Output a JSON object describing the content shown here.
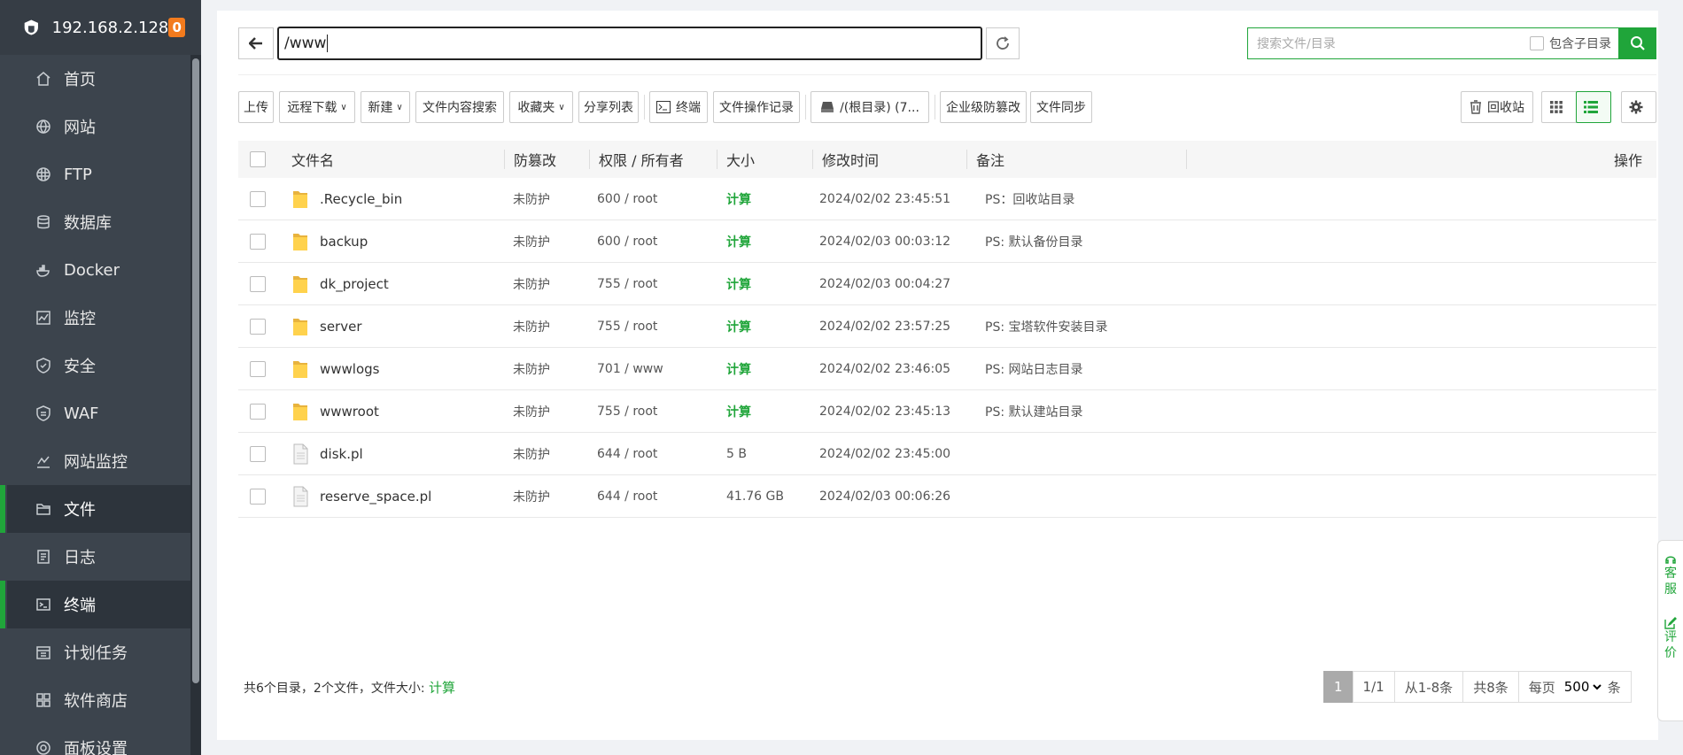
{
  "sidebar": {
    "ip": "192.168.2.128",
    "badge": "0",
    "items": [
      {
        "label": "首页",
        "icon": "home-icon"
      },
      {
        "label": "网站",
        "icon": "globe-icon"
      },
      {
        "label": "FTP",
        "icon": "ftp-icon"
      },
      {
        "label": "数据库",
        "icon": "database-icon"
      },
      {
        "label": "Docker",
        "icon": "docker-icon"
      },
      {
        "label": "监控",
        "icon": "monitor-icon"
      },
      {
        "label": "安全",
        "icon": "shield-icon"
      },
      {
        "label": "WAF",
        "icon": "waf-icon"
      },
      {
        "label": "网站监控",
        "icon": "chart-line-icon"
      },
      {
        "label": "文件",
        "icon": "folder-icon"
      },
      {
        "label": "日志",
        "icon": "log-icon"
      },
      {
        "label": "终端",
        "icon": "terminal-icon"
      },
      {
        "label": "计划任务",
        "icon": "calendar-icon"
      },
      {
        "label": "软件商店",
        "icon": "apps-icon"
      },
      {
        "label": "面板设置",
        "icon": "settings-icon"
      }
    ]
  },
  "path": {
    "value": "/www"
  },
  "search": {
    "placeholder": "搜索文件/目录",
    "include_sub": "包含子目录"
  },
  "toolbar": {
    "upload": "上传",
    "remote_download": "远程下载",
    "new": "新建",
    "content_search": "文件内容搜索",
    "favorites": "收藏夹",
    "share_list": "分享列表",
    "terminal": "终端",
    "op_log": "文件操作记录",
    "disk": "/(根目录) (7...",
    "tamper": "企业级防篡改",
    "sync": "文件同步",
    "recycle": "回收站"
  },
  "table": {
    "headers": {
      "name": "文件名",
      "tamper": "防篡改",
      "perm": "权限 / 所有者",
      "size": "大小",
      "mtime": "修改时间",
      "note": "备注",
      "ops": "操作"
    },
    "rows": [
      {
        "name": ".Recycle_bin",
        "type": "folder",
        "tamper": "未防护",
        "perm": "600 / root",
        "size": "计算",
        "mtime": "2024/02/02 23:45:51",
        "note": "PS：回收站目录"
      },
      {
        "name": "backup",
        "type": "folder",
        "tamper": "未防护",
        "perm": "600 / root",
        "size": "计算",
        "mtime": "2024/02/03 00:03:12",
        "note": "PS: 默认备份目录"
      },
      {
        "name": "dk_project",
        "type": "folder",
        "tamper": "未防护",
        "perm": "755 / root",
        "size": "计算",
        "mtime": "2024/02/03 00:04:27",
        "note": ""
      },
      {
        "name": "server",
        "type": "folder",
        "tamper": "未防护",
        "perm": "755 / root",
        "size": "计算",
        "mtime": "2024/02/02 23:57:25",
        "note": "PS: 宝塔软件安装目录"
      },
      {
        "name": "wwwlogs",
        "type": "folder",
        "tamper": "未防护",
        "perm": "701 / www",
        "size": "计算",
        "mtime": "2024/02/02 23:46:05",
        "note": "PS: 网站日志目录"
      },
      {
        "name": "wwwroot",
        "type": "folder",
        "tamper": "未防护",
        "perm": "755 / root",
        "size": "计算",
        "mtime": "2024/02/02 23:45:13",
        "note": "PS: 默认建站目录"
      },
      {
        "name": "disk.pl",
        "type": "file",
        "tamper": "未防护",
        "perm": "644 / root",
        "size": "5 B",
        "mtime": "2024/02/02 23:45:00",
        "note": ""
      },
      {
        "name": "reserve_space.pl",
        "type": "file",
        "tamper": "未防护",
        "perm": "644 / root",
        "size": "41.76 GB",
        "mtime": "2024/02/03 00:06:26",
        "note": ""
      }
    ]
  },
  "footer": {
    "summary": "共6个目录，2个文件，文件大小:",
    "calc": "计算",
    "page": "1",
    "pages": "1/1",
    "range": "从1-8条",
    "total": "共8条",
    "per_page_label": "每页",
    "per_page": "500",
    "unit": "条"
  },
  "float_widget": {
    "service": [
      "客",
      "服"
    ],
    "review": [
      "评",
      "价"
    ]
  },
  "colors": {
    "accent": "#20a53a",
    "sidebar_bg": "#3c444d",
    "badge": "#f37b1d"
  }
}
